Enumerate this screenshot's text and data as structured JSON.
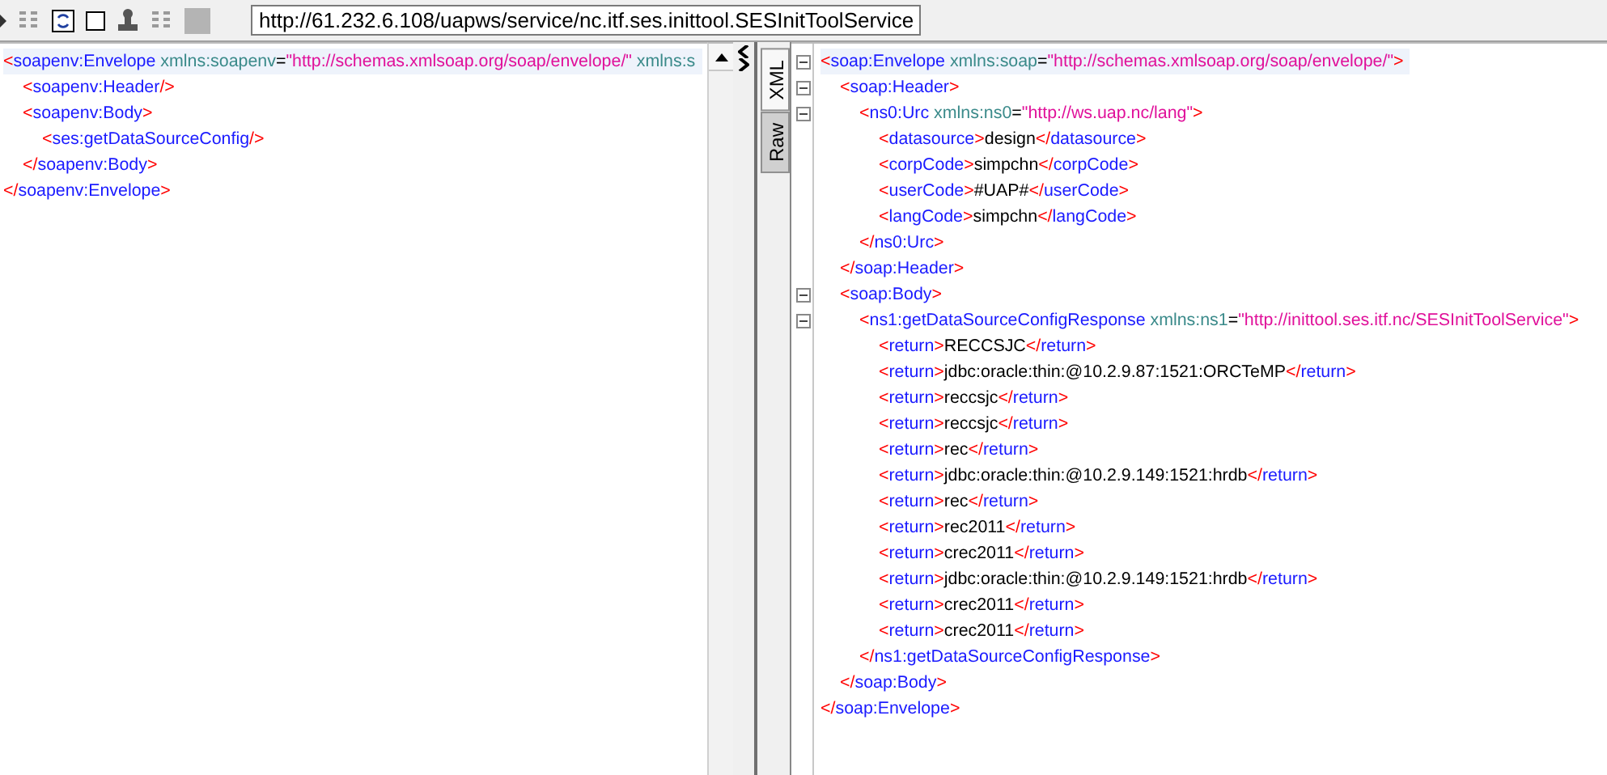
{
  "toolbar": {
    "url": "http://61.232.6.108/uapws/service/nc.itf.ses.inittool.SESInitToolService"
  },
  "request": {
    "lines": [
      {
        "highlighted": true,
        "open": [
          {
            "kind": "bracket",
            "text": "<"
          },
          {
            "kind": "name",
            "text": "soapenv:Envelope"
          },
          {
            "kind": "attr",
            "text": " xmlns:soapenv"
          },
          {
            "kind": "eq",
            "text": "="
          },
          {
            "kind": "value",
            "text": "\"http://schemas.xmlsoap.org/soap/envelope/\""
          },
          {
            "kind": "attr",
            "text": " xmlns:s"
          }
        ],
        "children": [
          {
            "open": [
              {
                "kind": "bracket",
                "text": "<"
              },
              {
                "kind": "name",
                "text": "soapenv:Header"
              },
              {
                "kind": "bracket",
                "text": "/>"
              }
            ]
          },
          {
            "open": [
              {
                "kind": "bracket",
                "text": "<"
              },
              {
                "kind": "name",
                "text": "soapenv:Body"
              },
              {
                "kind": "bracket",
                "text": ">"
              }
            ],
            "children": [
              {
                "open": [
                  {
                    "kind": "bracket",
                    "text": "<"
                  },
                  {
                    "kind": "name",
                    "text": "ses:getDataSourceConfig"
                  },
                  {
                    "kind": "bracket",
                    "text": "/>"
                  }
                ]
              }
            ],
            "close": [
              {
                "kind": "bracket",
                "text": "</"
              },
              {
                "kind": "name",
                "text": "soapenv:Body"
              },
              {
                "kind": "bracket",
                "text": ">"
              }
            ]
          }
        ],
        "close": [
          {
            "kind": "bracket",
            "text": "</"
          },
          {
            "kind": "name",
            "text": "soapenv:Envelope"
          },
          {
            "kind": "bracket",
            "text": ">"
          }
        ]
      }
    ]
  },
  "tabs": [
    {
      "label": "XML",
      "selected": true
    },
    {
      "label": "Raw",
      "selected": false
    }
  ],
  "response": {
    "lines": [
      {
        "highlighted": true,
        "foldable": true,
        "open": [
          {
            "kind": "bracket",
            "text": "<"
          },
          {
            "kind": "name",
            "text": "soap:Envelope"
          },
          {
            "kind": "attr",
            "text": " xmlns:soap"
          },
          {
            "kind": "eq",
            "text": "="
          },
          {
            "kind": "value",
            "text": "\"http://schemas.xmlsoap.org/soap/envelope/\""
          },
          {
            "kind": "bracket",
            "text": ">"
          }
        ],
        "children": [
          {
            "foldable": true,
            "open": [
              {
                "kind": "bracket",
                "text": "<"
              },
              {
                "kind": "name",
                "text": "soap:Header"
              },
              {
                "kind": "bracket",
                "text": ">"
              }
            ],
            "children": [
              {
                "foldable": true,
                "open": [
                  {
                    "kind": "bracket",
                    "text": "<"
                  },
                  {
                    "kind": "name",
                    "text": "ns0:Urc"
                  },
                  {
                    "kind": "attr",
                    "text": " xmlns:ns0"
                  },
                  {
                    "kind": "eq",
                    "text": "="
                  },
                  {
                    "kind": "value",
                    "text": "\"http://ws.uap.nc/lang\""
                  },
                  {
                    "kind": "bracket",
                    "text": ">"
                  }
                ],
                "children": [
                  {
                    "open": [
                      {
                        "kind": "bracket",
                        "text": "<"
                      },
                      {
                        "kind": "name",
                        "text": "datasource"
                      },
                      {
                        "kind": "bracket",
                        "text": ">"
                      },
                      {
                        "kind": "text",
                        "text": "design"
                      },
                      {
                        "kind": "bracket",
                        "text": "</"
                      },
                      {
                        "kind": "name",
                        "text": "datasource"
                      },
                      {
                        "kind": "bracket",
                        "text": ">"
                      }
                    ]
                  },
                  {
                    "open": [
                      {
                        "kind": "bracket",
                        "text": "<"
                      },
                      {
                        "kind": "name",
                        "text": "corpCode"
                      },
                      {
                        "kind": "bracket",
                        "text": ">"
                      },
                      {
                        "kind": "text",
                        "text": "simpchn"
                      },
                      {
                        "kind": "bracket",
                        "text": "</"
                      },
                      {
                        "kind": "name",
                        "text": "corpCode"
                      },
                      {
                        "kind": "bracket",
                        "text": ">"
                      }
                    ]
                  },
                  {
                    "open": [
                      {
                        "kind": "bracket",
                        "text": "<"
                      },
                      {
                        "kind": "name",
                        "text": "userCode"
                      },
                      {
                        "kind": "bracket",
                        "text": ">"
                      },
                      {
                        "kind": "text",
                        "text": "#UAP#"
                      },
                      {
                        "kind": "bracket",
                        "text": "</"
                      },
                      {
                        "kind": "name",
                        "text": "userCode"
                      },
                      {
                        "kind": "bracket",
                        "text": ">"
                      }
                    ]
                  },
                  {
                    "open": [
                      {
                        "kind": "bracket",
                        "text": "<"
                      },
                      {
                        "kind": "name",
                        "text": "langCode"
                      },
                      {
                        "kind": "bracket",
                        "text": ">"
                      },
                      {
                        "kind": "text",
                        "text": "simpchn"
                      },
                      {
                        "kind": "bracket",
                        "text": "</"
                      },
                      {
                        "kind": "name",
                        "text": "langCode"
                      },
                      {
                        "kind": "bracket",
                        "text": ">"
                      }
                    ]
                  }
                ],
                "close": [
                  {
                    "kind": "bracket",
                    "text": "</"
                  },
                  {
                    "kind": "name",
                    "text": "ns0:Urc"
                  },
                  {
                    "kind": "bracket",
                    "text": ">"
                  }
                ]
              }
            ],
            "close": [
              {
                "kind": "bracket",
                "text": "</"
              },
              {
                "kind": "name",
                "text": "soap:Header"
              },
              {
                "kind": "bracket",
                "text": ">"
              }
            ]
          },
          {
            "foldable": true,
            "open": [
              {
                "kind": "bracket",
                "text": "<"
              },
              {
                "kind": "name",
                "text": "soap:Body"
              },
              {
                "kind": "bracket",
                "text": ">"
              }
            ],
            "children": [
              {
                "foldable": true,
                "open": [
                  {
                    "kind": "bracket",
                    "text": "<"
                  },
                  {
                    "kind": "name",
                    "text": "ns1:getDataSourceConfigResponse"
                  },
                  {
                    "kind": "attr",
                    "text": " xmlns:ns1"
                  },
                  {
                    "kind": "eq",
                    "text": "="
                  },
                  {
                    "kind": "value",
                    "text": "\"http://inittool.ses.itf.nc/SESInitToolService\""
                  },
                  {
                    "kind": "bracket",
                    "text": ">"
                  }
                ],
                "children": [
                  {
                    "open": [
                      {
                        "kind": "bracket",
                        "text": "<"
                      },
                      {
                        "kind": "name",
                        "text": "return"
                      },
                      {
                        "kind": "bracket",
                        "text": ">"
                      },
                      {
                        "kind": "text",
                        "text": "RECCSJC"
                      },
                      {
                        "kind": "bracket",
                        "text": "</"
                      },
                      {
                        "kind": "name",
                        "text": "return"
                      },
                      {
                        "kind": "bracket",
                        "text": ">"
                      }
                    ]
                  },
                  {
                    "open": [
                      {
                        "kind": "bracket",
                        "text": "<"
                      },
                      {
                        "kind": "name",
                        "text": "return"
                      },
                      {
                        "kind": "bracket",
                        "text": ">"
                      },
                      {
                        "kind": "text",
                        "text": "jdbc:oracle:thin:@10.2.9.87:1521:ORCTeMP"
                      },
                      {
                        "kind": "bracket",
                        "text": "</"
                      },
                      {
                        "kind": "name",
                        "text": "return"
                      },
                      {
                        "kind": "bracket",
                        "text": ">"
                      }
                    ]
                  },
                  {
                    "open": [
                      {
                        "kind": "bracket",
                        "text": "<"
                      },
                      {
                        "kind": "name",
                        "text": "return"
                      },
                      {
                        "kind": "bracket",
                        "text": ">"
                      },
                      {
                        "kind": "text",
                        "text": "reccsjc"
                      },
                      {
                        "kind": "bracket",
                        "text": "</"
                      },
                      {
                        "kind": "name",
                        "text": "return"
                      },
                      {
                        "kind": "bracket",
                        "text": ">"
                      }
                    ]
                  },
                  {
                    "open": [
                      {
                        "kind": "bracket",
                        "text": "<"
                      },
                      {
                        "kind": "name",
                        "text": "return"
                      },
                      {
                        "kind": "bracket",
                        "text": ">"
                      },
                      {
                        "kind": "text",
                        "text": "reccsjc"
                      },
                      {
                        "kind": "bracket",
                        "text": "</"
                      },
                      {
                        "kind": "name",
                        "text": "return"
                      },
                      {
                        "kind": "bracket",
                        "text": ">"
                      }
                    ]
                  },
                  {
                    "open": [
                      {
                        "kind": "bracket",
                        "text": "<"
                      },
                      {
                        "kind": "name",
                        "text": "return"
                      },
                      {
                        "kind": "bracket",
                        "text": ">"
                      },
                      {
                        "kind": "text",
                        "text": "rec"
                      },
                      {
                        "kind": "bracket",
                        "text": "</"
                      },
                      {
                        "kind": "name",
                        "text": "return"
                      },
                      {
                        "kind": "bracket",
                        "text": ">"
                      }
                    ]
                  },
                  {
                    "open": [
                      {
                        "kind": "bracket",
                        "text": "<"
                      },
                      {
                        "kind": "name",
                        "text": "return"
                      },
                      {
                        "kind": "bracket",
                        "text": ">"
                      },
                      {
                        "kind": "text",
                        "text": "jdbc:oracle:thin:@10.2.9.149:1521:hrdb"
                      },
                      {
                        "kind": "bracket",
                        "text": "</"
                      },
                      {
                        "kind": "name",
                        "text": "return"
                      },
                      {
                        "kind": "bracket",
                        "text": ">"
                      }
                    ]
                  },
                  {
                    "open": [
                      {
                        "kind": "bracket",
                        "text": "<"
                      },
                      {
                        "kind": "name",
                        "text": "return"
                      },
                      {
                        "kind": "bracket",
                        "text": ">"
                      },
                      {
                        "kind": "text",
                        "text": "rec"
                      },
                      {
                        "kind": "bracket",
                        "text": "</"
                      },
                      {
                        "kind": "name",
                        "text": "return"
                      },
                      {
                        "kind": "bracket",
                        "text": ">"
                      }
                    ]
                  },
                  {
                    "open": [
                      {
                        "kind": "bracket",
                        "text": "<"
                      },
                      {
                        "kind": "name",
                        "text": "return"
                      },
                      {
                        "kind": "bracket",
                        "text": ">"
                      },
                      {
                        "kind": "text",
                        "text": "rec2011"
                      },
                      {
                        "kind": "bracket",
                        "text": "</"
                      },
                      {
                        "kind": "name",
                        "text": "return"
                      },
                      {
                        "kind": "bracket",
                        "text": ">"
                      }
                    ]
                  },
                  {
                    "open": [
                      {
                        "kind": "bracket",
                        "text": "<"
                      },
                      {
                        "kind": "name",
                        "text": "return"
                      },
                      {
                        "kind": "bracket",
                        "text": ">"
                      },
                      {
                        "kind": "text",
                        "text": "crec2011"
                      },
                      {
                        "kind": "bracket",
                        "text": "</"
                      },
                      {
                        "kind": "name",
                        "text": "return"
                      },
                      {
                        "kind": "bracket",
                        "text": ">"
                      }
                    ]
                  },
                  {
                    "open": [
                      {
                        "kind": "bracket",
                        "text": "<"
                      },
                      {
                        "kind": "name",
                        "text": "return"
                      },
                      {
                        "kind": "bracket",
                        "text": ">"
                      },
                      {
                        "kind": "text",
                        "text": "jdbc:oracle:thin:@10.2.9.149:1521:hrdb"
                      },
                      {
                        "kind": "bracket",
                        "text": "</"
                      },
                      {
                        "kind": "name",
                        "text": "return"
                      },
                      {
                        "kind": "bracket",
                        "text": ">"
                      }
                    ]
                  },
                  {
                    "open": [
                      {
                        "kind": "bracket",
                        "text": "<"
                      },
                      {
                        "kind": "name",
                        "text": "return"
                      },
                      {
                        "kind": "bracket",
                        "text": ">"
                      },
                      {
                        "kind": "text",
                        "text": "crec2011"
                      },
                      {
                        "kind": "bracket",
                        "text": "</"
                      },
                      {
                        "kind": "name",
                        "text": "return"
                      },
                      {
                        "kind": "bracket",
                        "text": ">"
                      }
                    ]
                  },
                  {
                    "open": [
                      {
                        "kind": "bracket",
                        "text": "<"
                      },
                      {
                        "kind": "name",
                        "text": "return"
                      },
                      {
                        "kind": "bracket",
                        "text": ">"
                      },
                      {
                        "kind": "text",
                        "text": "crec2011"
                      },
                      {
                        "kind": "bracket",
                        "text": "</"
                      },
                      {
                        "kind": "name",
                        "text": "return"
                      },
                      {
                        "kind": "bracket",
                        "text": ">"
                      }
                    ]
                  }
                ],
                "close": [
                  {
                    "kind": "bracket",
                    "text": "</"
                  },
                  {
                    "kind": "name",
                    "text": "ns1:getDataSourceConfigResponse"
                  },
                  {
                    "kind": "bracket",
                    "text": ">"
                  }
                ]
              }
            ],
            "close": [
              {
                "kind": "bracket",
                "text": "</"
              },
              {
                "kind": "name",
                "text": "soap:Body"
              },
              {
                "kind": "bracket",
                "text": ">"
              }
            ]
          }
        ],
        "close": [
          {
            "kind": "bracket",
            "text": "</"
          },
          {
            "kind": "name",
            "text": "soap:Envelope"
          },
          {
            "kind": "bracket",
            "text": ">"
          }
        ]
      }
    ]
  }
}
